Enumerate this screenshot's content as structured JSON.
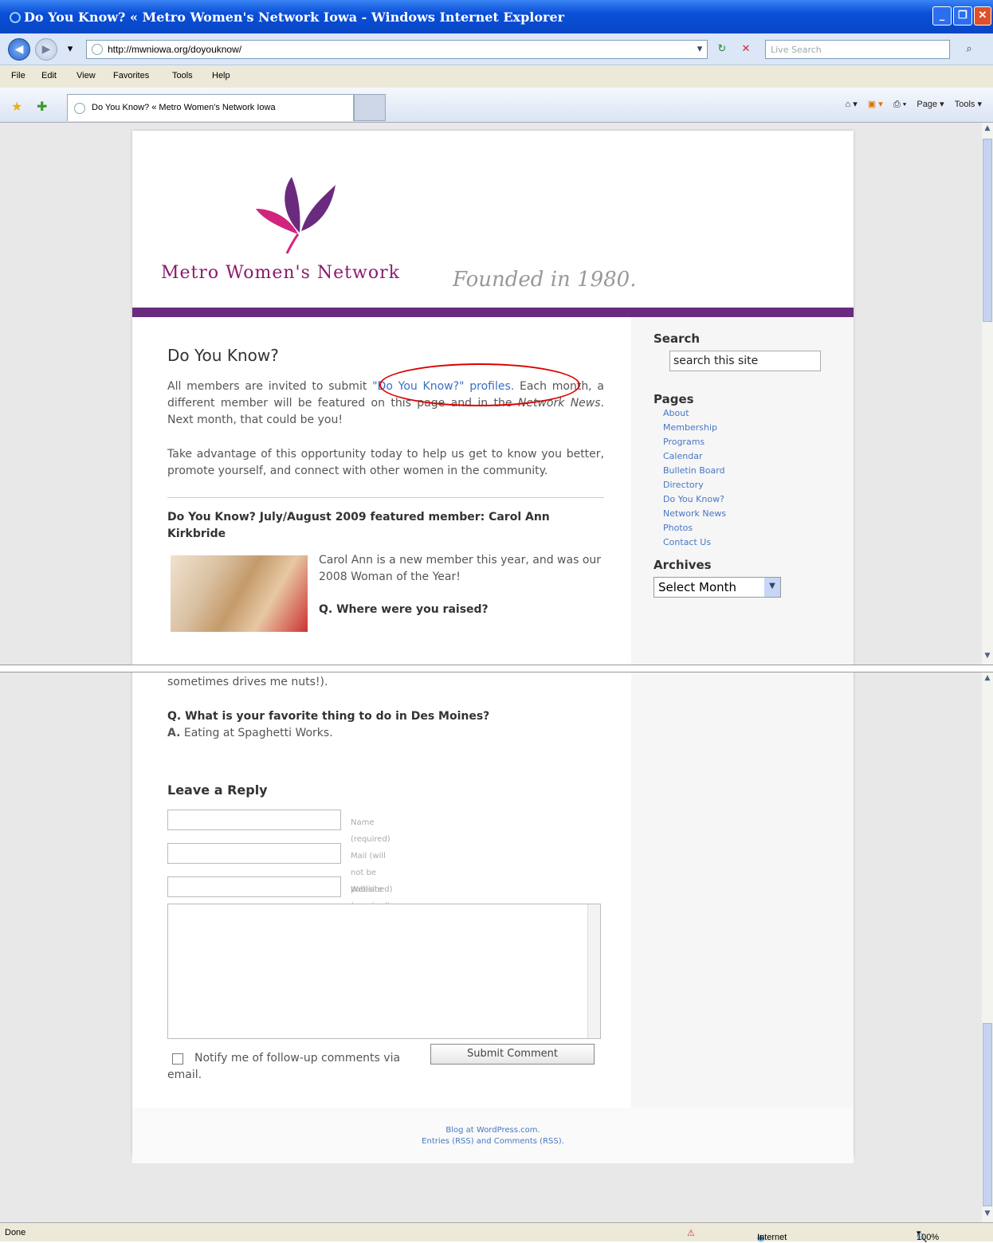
{
  "browser": {
    "window_title": "Do You Know? « Metro Women's Network Iowa - Windows Internet Explorer",
    "address": "http://mwniowa.org/doyouknow/",
    "live_search_placeholder": "Live Search",
    "menu": [
      "File",
      "Edit",
      "View",
      "Favorites",
      "Tools",
      "Help"
    ],
    "tab_title": "Do You Know? « Metro Women's Network Iowa",
    "toolbar_right": [
      "Page ▾",
      "Tools ▾"
    ],
    "status_left": "Done",
    "status_zone": "Internet",
    "status_zoom": "100%"
  },
  "header": {
    "logo_text": "Metro Women's Network",
    "tagline": "Founded in 1980."
  },
  "main": {
    "title": "Do You Know?",
    "intro_before": "All members are invited to submit ",
    "intro_link": "\"Do You Know?\" profiles.",
    "intro_after": " Each month, a different member will be featured on this page and in the ",
    "intro_em": "Network News",
    "intro_end": ". Next month, that could be you!",
    "para2": "Take advantage of this opportunity today to help us get to know you better, promote yourself, and connect with other women in the community.",
    "featured": "Do You Know? July/August 2009 featured member: Carol Ann Kirkbride",
    "bio": "Carol Ann is a new member this year, and was our 2008 Woman of the Year!",
    "q1": "Q. Where were you raised?",
    "a1_tail": "sometimes drives me nuts!).",
    "q2": "Q. What is your favorite thing to do in Des Moines?",
    "a2_label": "A.",
    "a2": " Eating at Spaghetti Works."
  },
  "sidebar": {
    "search_title": "Search",
    "search_value": "search this site",
    "pages_title": "Pages",
    "pages": [
      "About",
      "Membership",
      "Programs",
      "Calendar",
      "Bulletin Board",
      "Directory",
      "Do You Know?",
      "Network News",
      "Photos",
      "Contact Us"
    ],
    "archives_title": "Archives",
    "archives_select": "Select Month"
  },
  "reply": {
    "title": "Leave a Reply",
    "name_label": "Name (required)",
    "mail_label": "Mail (will not be published) (required)",
    "website_label": "Website",
    "notify": "Notify me of follow-up comments via email.",
    "submit": "Submit Comment"
  },
  "footer": {
    "line1": "Blog at WordPress.com.",
    "line2": "Entries (RSS) and Comments (RSS)."
  },
  "colors": {
    "brand_purple": "#6a2b7f",
    "logo_magenta": "#8d1a6e",
    "link": "#3b6fc2"
  }
}
